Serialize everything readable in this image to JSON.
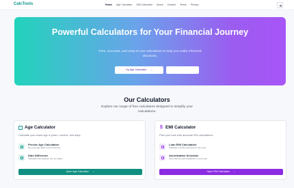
{
  "brand": {
    "name": "CalcTools",
    "accent": "#0d9488"
  },
  "nav": {
    "items": [
      {
        "label": "Home",
        "active": true
      },
      {
        "label": "Age Calculator",
        "active": false
      },
      {
        "label": "EMI Calculator",
        "active": false
      },
      {
        "label": "About",
        "active": false
      },
      {
        "label": "Contact",
        "active": false
      },
      {
        "label": "Terms",
        "active": false
      },
      {
        "label": "Privacy",
        "active": false
      }
    ],
    "theme_toggle_icon": "sun-icon"
  },
  "hero": {
    "title": "Powerful Calculators for Your Financial Journey",
    "subtitle": "Free, accurate, and easy-to-use calculators to help you make informed decisions.",
    "primary_button": "Try Age Calculator",
    "primary_button_arrow": "→",
    "secondary_button": "",
    "gradient": [
      "#22d3bb",
      "#6aa3ea",
      "#a855f7"
    ]
  },
  "section": {
    "title": "Our Calculators",
    "subtitle": "Explore our range of free calculators designed to simplify your calculations."
  },
  "cards": [
    {
      "icon": "calendar-icon",
      "title": "Age Calculator",
      "description": "Calculate your exact age in years, months, and days.",
      "features": [
        {
          "icon": "user-icon",
          "title": "Precise Age Calculation",
          "desc": "Get your age down to the exact day"
        },
        {
          "icon": "calendar-icon",
          "title": "Date Difference",
          "desc": "Calculate time between any two dates"
        }
      ],
      "button": "Open Age Calculator",
      "arrow": "→",
      "color": "#0f8f80"
    },
    {
      "icon": "dollar-icon",
      "icon_glyph": "$",
      "title": "EMI Calculator",
      "description": "Plan your loan with accurate EMI calculations.",
      "features": [
        {
          "icon": "card-icon",
          "title": "Loan EMI Calculation",
          "desc": "Calculate monthly payments for any loan"
        },
        {
          "icon": "chart-icon",
          "title": "Amortization Schedule",
          "desc": "View year-by-year breakdown of your loan"
        }
      ],
      "button": "Open EMI Calculator",
      "arrow": "→",
      "color": "#8b2be2"
    }
  ]
}
